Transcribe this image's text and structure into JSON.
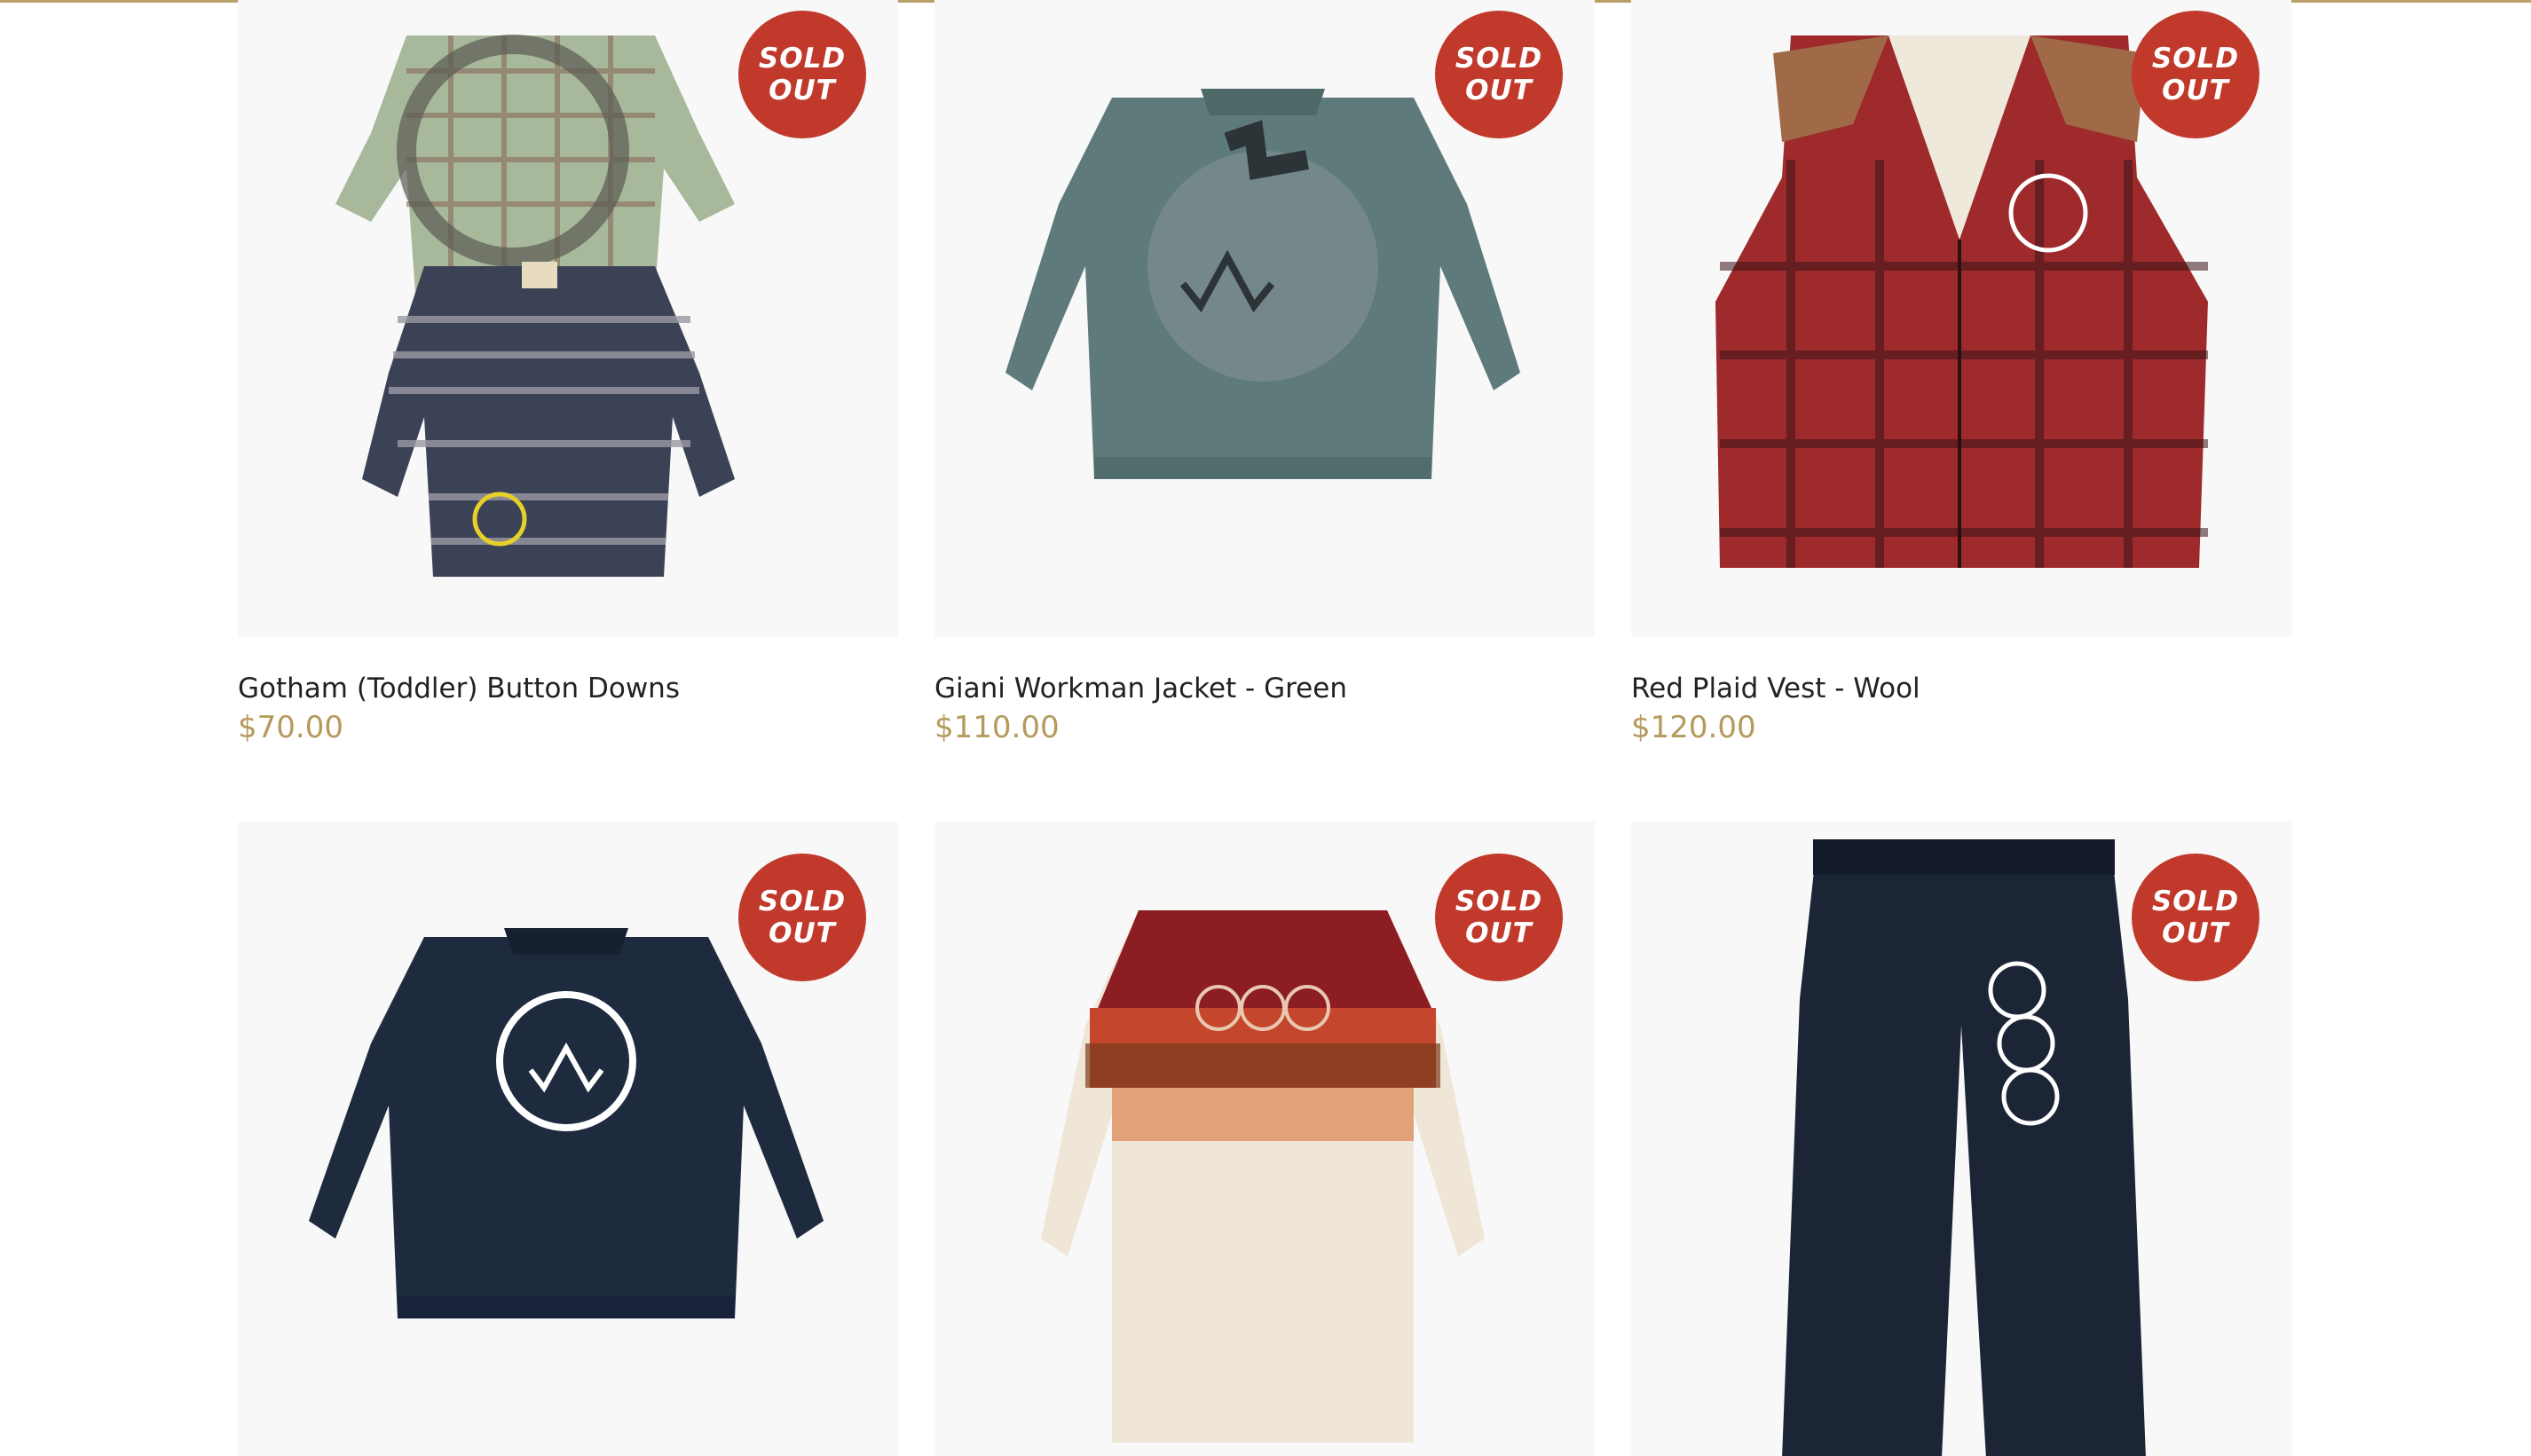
{
  "colors": {
    "accent_line": "#b9a06a",
    "badge": "#c0392b",
    "price": "#b59a5c",
    "title": "#222222"
  },
  "products": [
    {
      "title": "Gotham (Toddler) Button Downs",
      "price": "$70.00",
      "badge_line1": "SOLD",
      "badge_line2": "OUT",
      "image": "two-plaid-toddler-shirts"
    },
    {
      "title": "Giani Workman Jacket - Green",
      "price": "$110.00",
      "badge_line1": "SOLD",
      "badge_line2": "OUT",
      "image": "green-work-jacket"
    },
    {
      "title": "Red Plaid Vest - Wool",
      "price": "$120.00",
      "badge_line1": "SOLD",
      "badge_line2": "OUT",
      "image": "red-plaid-vest"
    },
    {
      "title": "",
      "price": "",
      "badge_line1": "SOLD",
      "badge_line2": "OUT",
      "image": "navy-work-jacket"
    },
    {
      "title": "",
      "price": "",
      "badge_line1": "SOLD",
      "badge_line2": "OUT",
      "image": "western-shirt"
    },
    {
      "title": "",
      "price": "",
      "badge_line1": "SOLD",
      "badge_line2": "OUT",
      "image": "navy-work-pants"
    }
  ]
}
